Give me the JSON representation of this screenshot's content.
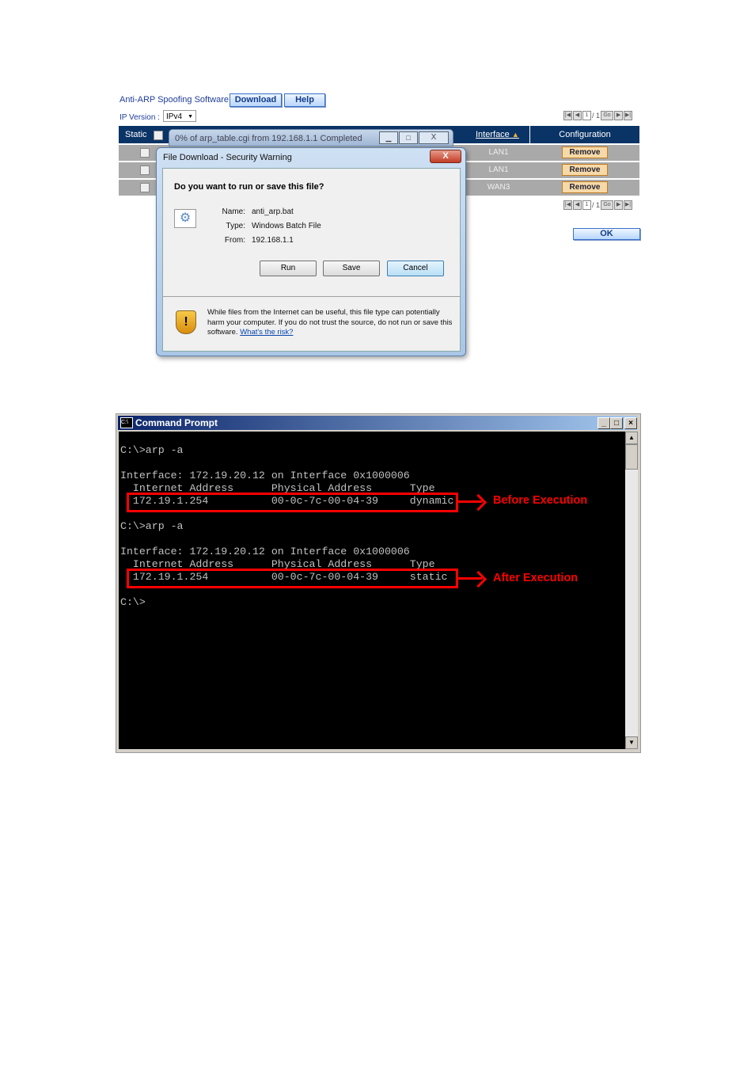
{
  "web": {
    "title": "Anti-ARP Spoofing Software",
    "download": "Download",
    "help": "Help",
    "ip_version_label": "IP Version :",
    "ip_version": "IPv4",
    "pager": {
      "page": "1",
      "total": "/ 1",
      "go": "Go"
    },
    "headers": {
      "static": "Static",
      "interface": "Interface",
      "configuration": "Configuration"
    },
    "rows": [
      {
        "interface": "LAN1",
        "action": "Remove"
      },
      {
        "interface": "LAN1",
        "action": "Remove"
      },
      {
        "interface": "WAN3",
        "action": "Remove"
      }
    ],
    "ok": "OK"
  },
  "progress": {
    "title": "0% of arp_table.cgi from 192.168.1.1 Completed"
  },
  "dialog": {
    "title": "File Download - Security Warning",
    "close": "X",
    "question": "Do you want to run or save this file?",
    "name_label": "Name:",
    "name": "anti_arp.bat",
    "type_label": "Type:",
    "type": "Windows Batch File",
    "from_label": "From:",
    "from": "192.168.1.1",
    "run": "Run",
    "save": "Save",
    "cancel": "Cancel",
    "warning": "While files from the Internet can be useful, this file type can potentially harm your computer. If you do not trust the source, do not run or save this software.",
    "risk_link": "What's the risk?"
  },
  "cmd": {
    "title": "Command Prompt",
    "icon": "C:\\",
    "output": "C:\\>arp -a\n\nInterface: 172.19.20.12 on Interface 0x1000006\n  Internet Address      Physical Address      Type\n  172.19.1.254          00-0c-7c-00-04-39     dynamic\n\nC:\\>arp -a\n\nInterface: 172.19.20.12 on Interface 0x1000006\n  Internet Address      Physical Address      Type\n  172.19.1.254          00-0c-7c-00-04-39     static\n\nC:\\>"
  },
  "annotations": {
    "before": "Before Execution",
    "after": "After Execution",
    "color": "#ff0000"
  }
}
